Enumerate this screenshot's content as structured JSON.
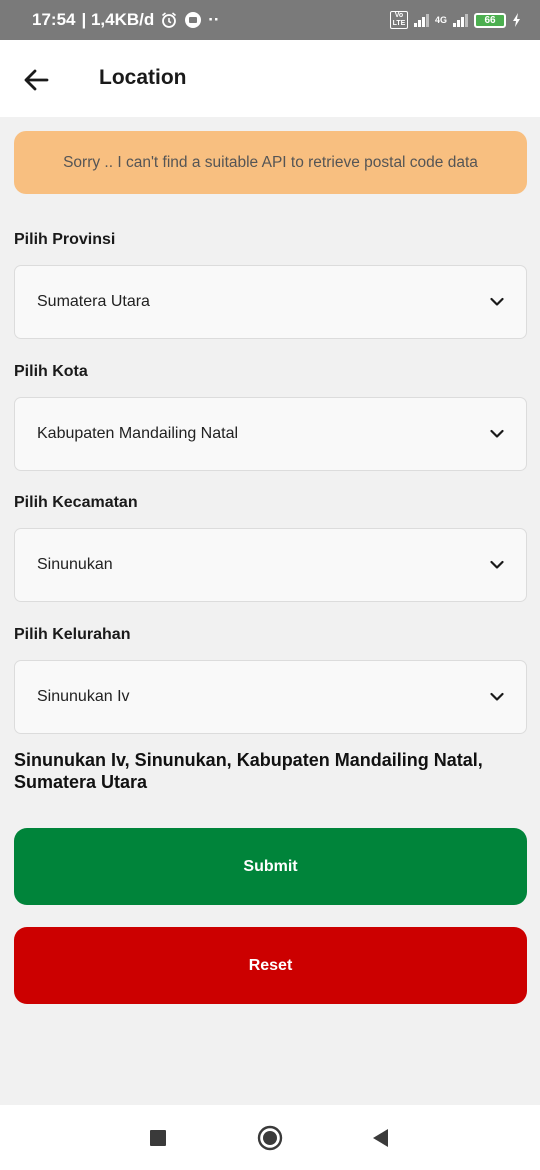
{
  "status_bar": {
    "time": "17:54",
    "speed": "| 1,4KB/d",
    "dots": "··",
    "lte": "Vo LTE",
    "network": "4G",
    "battery": "66"
  },
  "appbar": {
    "title": "Location",
    "back_icon": "arrow-left-icon"
  },
  "notice": {
    "text": "Sorry .. I can't find a suitable API to retrieve postal code data",
    "color": "#f8bf80"
  },
  "form": {
    "provinsi": {
      "label": "Pilih Provinsi",
      "value": "Sumatera Utara"
    },
    "kota": {
      "label": "Pilih Kota",
      "value": "Kabupaten Mandailing Natal"
    },
    "kecamatan": {
      "label": "Pilih Kecamatan",
      "value": "Sinunukan"
    },
    "kelurahan": {
      "label": "Pilih Kelurahan",
      "value": "Sinunukan Iv"
    }
  },
  "summary": "Sinunukan Iv, Sinunukan, Kabupaten Mandailing Natal, Sumatera Utara",
  "buttons": {
    "submit": {
      "label": "Submit",
      "color": "#00843a"
    },
    "reset": {
      "label": "Reset",
      "color": "#cc0000"
    }
  },
  "navbar": {
    "recents_icon": "square-icon",
    "home_icon": "circle-home-icon",
    "back_icon": "triangle-back-icon"
  }
}
